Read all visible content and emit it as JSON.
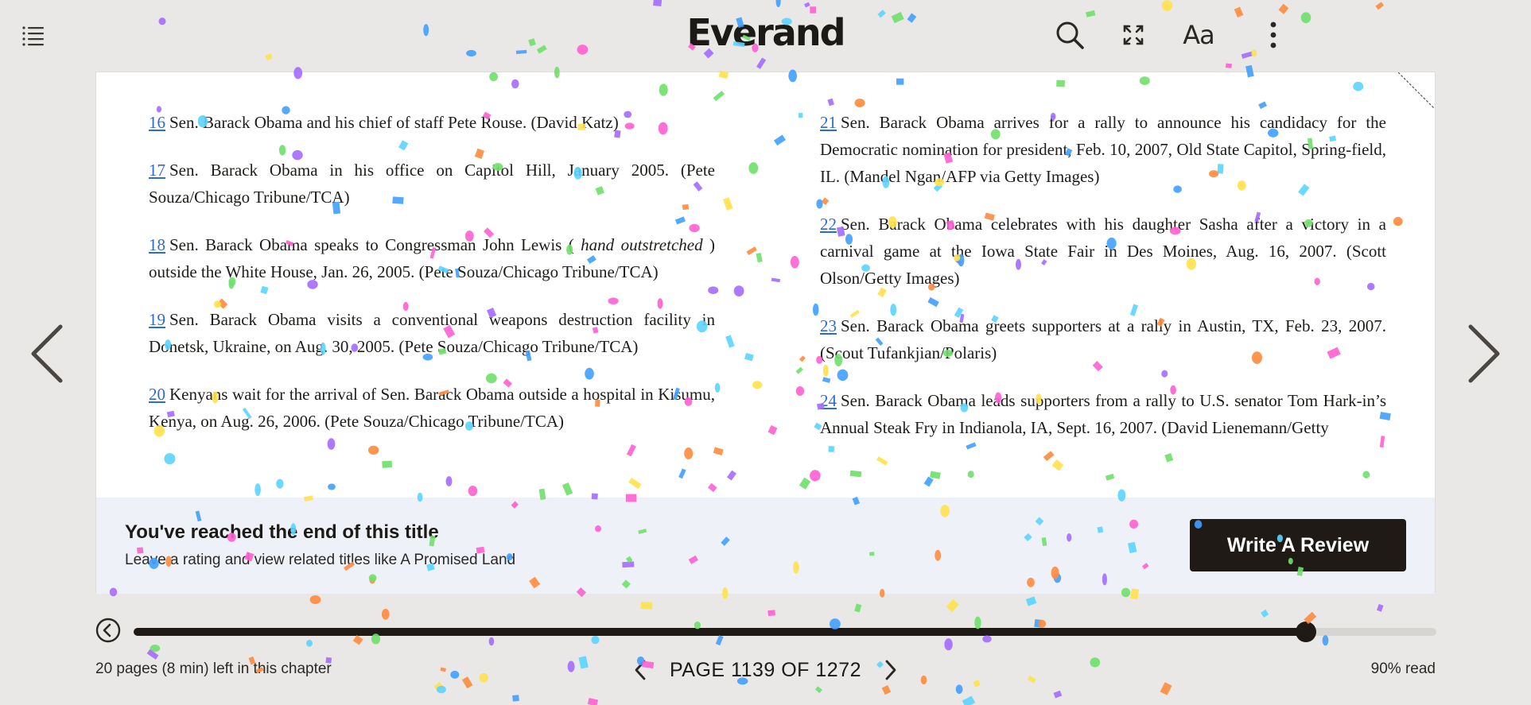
{
  "app": {
    "logo": "Everand"
  },
  "toolbar": {
    "toc_icon": "list-icon",
    "search_icon": "search-icon",
    "fullscreen_icon": "fullscreen-icon",
    "font_settings_label": "Aa",
    "more_icon": "more-vertical-icon"
  },
  "page": {
    "left_notes": [
      {
        "num": "16",
        "text": "Sen. Barack Obama and his chief of staff Pete Rouse. (David Katz)"
      },
      {
        "num": "17",
        "text": "Sen. Barack Obama in his office on Capitol Hill, January 2005. (Pete Souza/Chicago Tribune/TCA)"
      },
      {
        "num": "18",
        "text_before": "Sen. Barack Obama speaks to Congressman John Lewis ( ",
        "italic": "hand outstretched",
        "text_after": " ) outside the White House, Jan. 26, 2005. (Pete Souza/Chicago Tribune/TCA)"
      },
      {
        "num": "19",
        "text": "Sen. Barack Obama visits a conventional weapons destruction facility in Donetsk, Ukraine, on Aug. 30, 2005. (Pete Souza/Chicago Tribune/TCA)"
      },
      {
        "num": "20",
        "text": "Kenyans wait for the arrival of Sen. Barack Obama outside a hospital in Kisumu, Kenya, on Aug. 26, 2006. (Pete Souza/Chicago Tribune/TCA)"
      }
    ],
    "right_notes": [
      {
        "num": "21",
        "text": "Sen. Barack Obama arrives for a rally to announce his candidacy for the Democratic nomination for president, Feb. 10, 2007, Old State Capitol, Spring-field, IL. (Mandel Ngan/AFP via Getty Images)"
      },
      {
        "num": "22",
        "text": "Sen. Barack Obama celebrates with his daughter Sasha after a victory in a carnival game at the Iowa State Fair in Des Moines, Aug. 16, 2007. (Scott Olson/Getty Images)"
      },
      {
        "num": "23",
        "text": "Sen. Barack Obama greets supporters at a rally in Austin, TX, Feb. 23, 2007. (Scout Tufankjian/Polaris)"
      },
      {
        "num": "24",
        "text": "Sen. Barack Obama leads supporters from a rally to U.S. senator Tom Hark-in’s Annual Steak Fry in Indianola, IA, Sept. 16, 2007. (David Lienemann/Getty"
      }
    ]
  },
  "end_banner": {
    "title": "You've reached the end of this title",
    "subtitle": "Leave a rating and view related titles like A Promised Land",
    "review_button": "Write A Review"
  },
  "progress": {
    "fraction": 0.9,
    "chapter_left": "20 pages (8 min) left in this chapter",
    "page_label": "PAGE 1139 OF 1272",
    "percent_read": "90% read"
  },
  "colors": {
    "accent_dark": "#1f1a15",
    "link": "#2b6ad8",
    "banner_bg": "#eff1f8",
    "background": "#e9e8e6"
  }
}
